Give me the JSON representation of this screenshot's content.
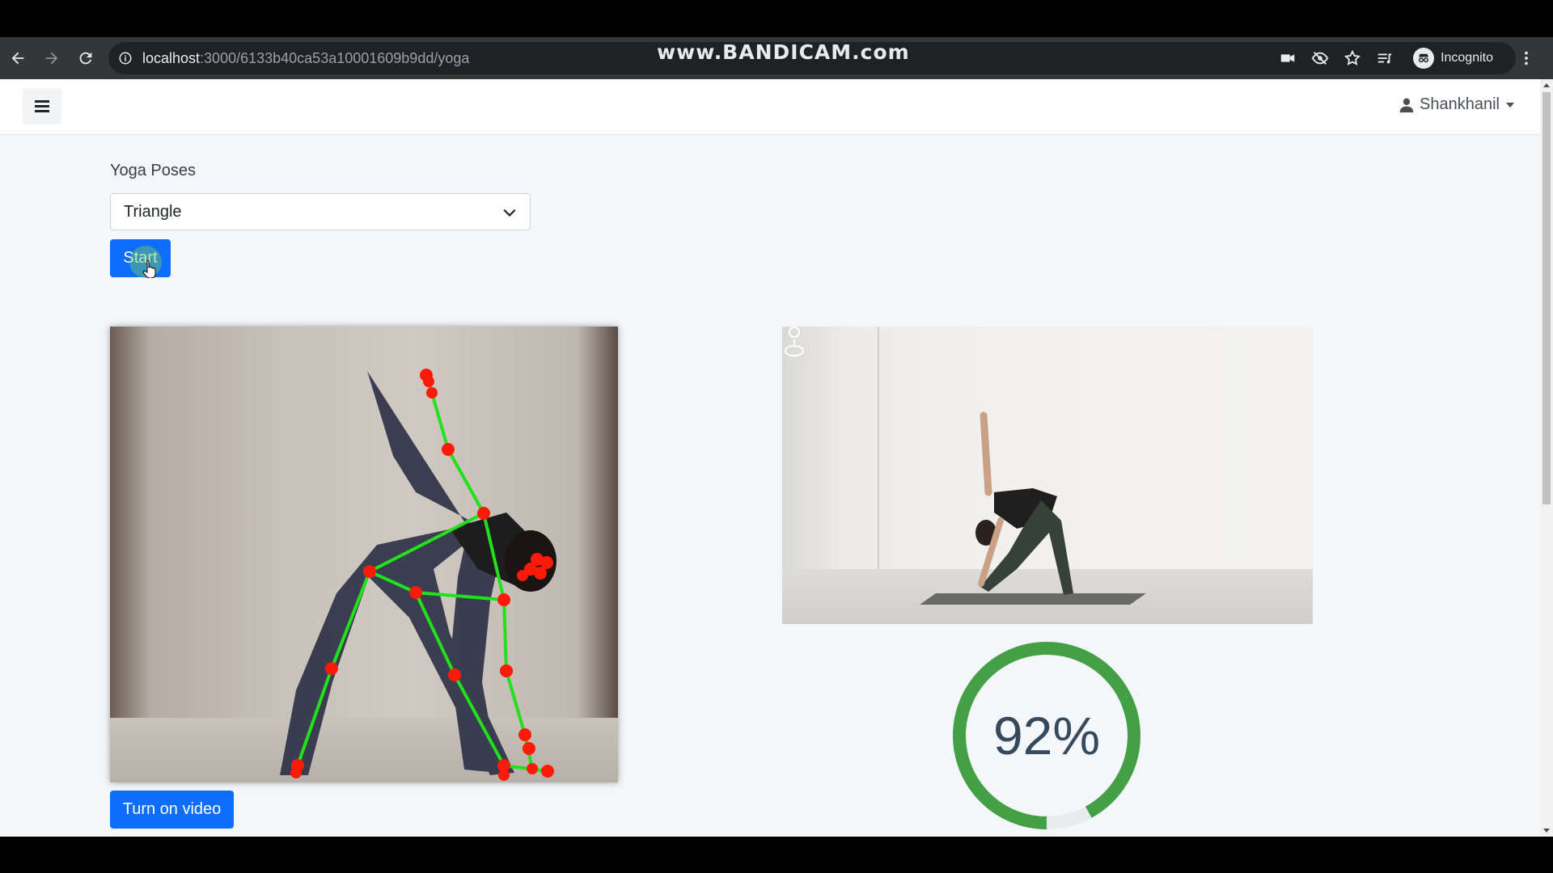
{
  "browser": {
    "url_host": "localhost",
    "url_path": ":3000/6133b40ca53a10001609b9dd/yoga",
    "watermark": "www.BANDICAM.com",
    "profile_label": "Incognito"
  },
  "app": {
    "user_name": "Shankhanil",
    "pose_label": "Yoga Poses",
    "selected_pose": "Triangle",
    "start_label": "Start",
    "turn_on_video_label": "Turn on video",
    "score_text": "92%",
    "score_fraction": 0.92
  },
  "colors": {
    "primary_button": "#0d6efd",
    "skeleton_line": "#22e01b",
    "keypoint": "#ff1a0a",
    "progress": "#43a047",
    "progress_track": "#e9ecec",
    "score_text": "#354a5c"
  }
}
